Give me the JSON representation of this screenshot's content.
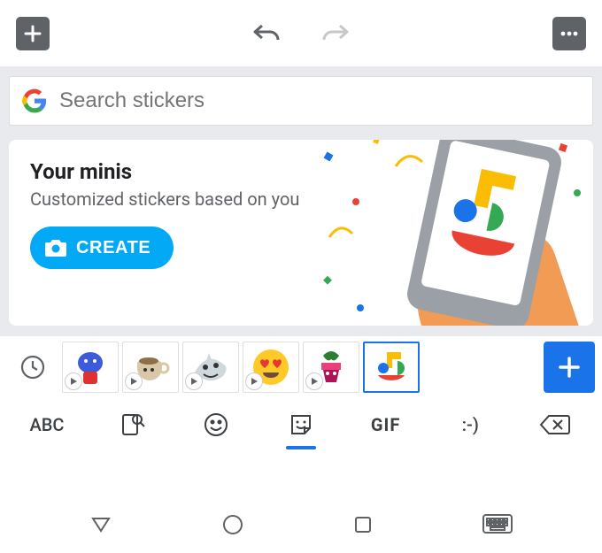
{
  "toolbar": {
    "add_label": "+",
    "more_label": "⋯"
  },
  "search": {
    "placeholder": "Search stickers"
  },
  "minis": {
    "title": "Your minis",
    "subtitle": "Customized stickers based on you",
    "create_label": "CREATE"
  },
  "sticker_categories": [
    {
      "name": "blue-character",
      "has_play": true,
      "selected": false
    },
    {
      "name": "coffee-cup",
      "has_play": true,
      "selected": false
    },
    {
      "name": "shark",
      "has_play": true,
      "selected": false
    },
    {
      "name": "heart-eyes-emoji",
      "has_play": true,
      "selected": false
    },
    {
      "name": "plant-pot",
      "has_play": true,
      "selected": false
    },
    {
      "name": "minis-face",
      "has_play": false,
      "selected": true
    }
  ],
  "keyboard_nav": {
    "abc_label": "ABC",
    "gif_label": "GIF",
    "emoticon_label": ":-)"
  }
}
